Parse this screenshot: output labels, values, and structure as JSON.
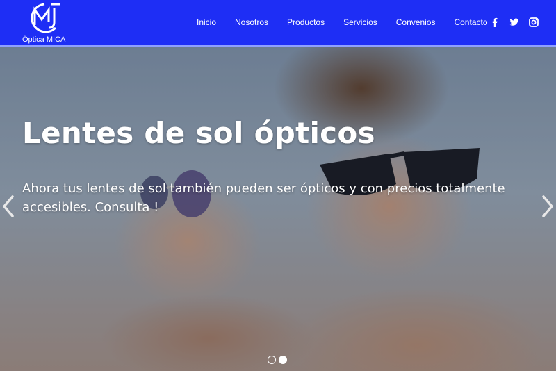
{
  "brand": {
    "logo_letters": "MJC",
    "name": "Óptica MICA",
    "color": "#1e2ef5"
  },
  "nav": {
    "items": [
      {
        "label": "Inicio"
      },
      {
        "label": "Nosotros"
      },
      {
        "label": "Productos"
      },
      {
        "label": "Servicios"
      },
      {
        "label": "Convenios"
      },
      {
        "label": "Contacto"
      }
    ]
  },
  "social": {
    "icons": [
      "facebook-icon",
      "twitter-icon",
      "instagram-icon"
    ]
  },
  "carousel": {
    "slide": {
      "title": "Lentes de sol ópticos",
      "text": "Ahora tus lentes de sol también pueden ser ópticos y con precios totalmente accesibles. Consulta !"
    },
    "prev_icon": "chevron-left-icon",
    "next_icon": "chevron-right-icon",
    "slide_count": 2,
    "active_index": 1
  }
}
